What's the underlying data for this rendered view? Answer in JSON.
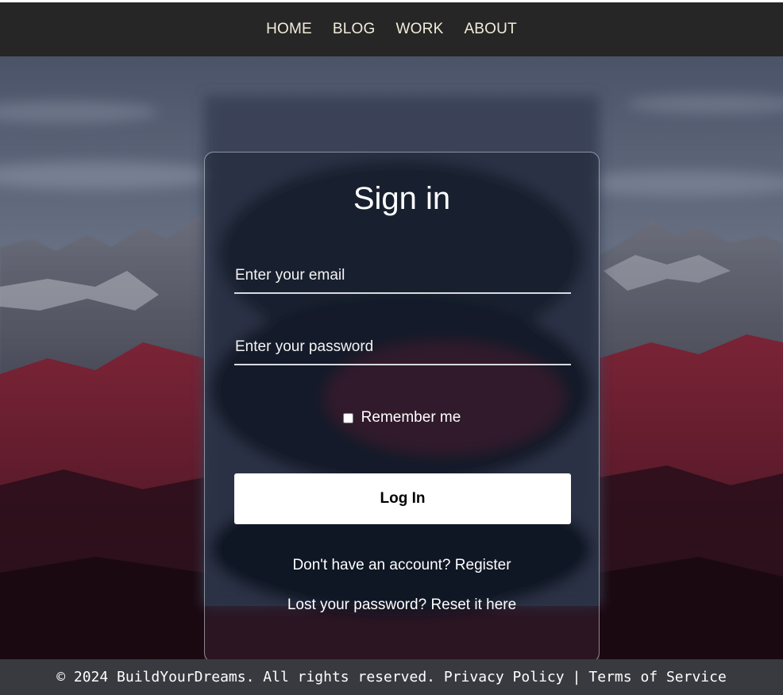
{
  "nav": {
    "items": [
      {
        "label": "HOME"
      },
      {
        "label": "BLOG"
      },
      {
        "label": "WORK"
      },
      {
        "label": "ABOUT"
      }
    ]
  },
  "signin": {
    "title": "Sign in",
    "email_placeholder": "Enter your email",
    "email_value": "",
    "password_placeholder": "Enter your password",
    "password_value": "",
    "remember_label": "Remember me",
    "remember_checked": false,
    "login_label": "Log In",
    "register_prompt": "Don't have an account?",
    "register_link": "Register",
    "reset_prompt": "Lost your password?",
    "reset_link": "Reset it here"
  },
  "footer": {
    "copyright": "© 2024 BuildYourDreams. All rights reserved.",
    "privacy_link": "Privacy Policy",
    "separator": "|",
    "terms_link": "Terms of Service"
  },
  "colors": {
    "navbar_bg": "#262626",
    "nav_text": "#f1ecdc",
    "footer_bg": "#383a3f",
    "button_bg": "#ffffff",
    "button_text": "#000000"
  }
}
